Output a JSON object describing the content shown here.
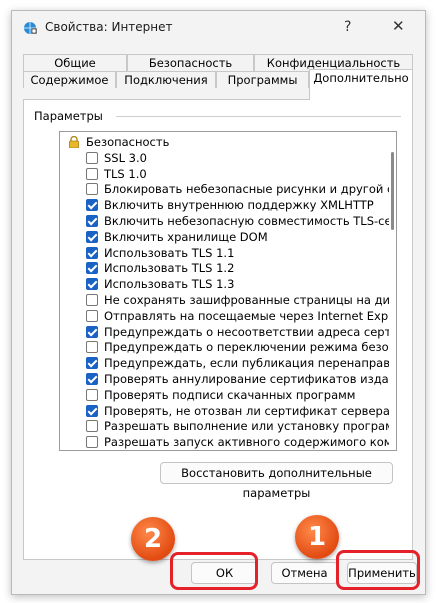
{
  "window": {
    "title": "Свойства: Интернет",
    "help": "?",
    "close": "✕"
  },
  "tabs_row1": [
    "Общие",
    "Безопасность",
    "Конфиденциальность"
  ],
  "tabs_row2": [
    "Содержимое",
    "Подключения",
    "Программы",
    "Дополнительно"
  ],
  "group_label": "Параметры",
  "list_header": "Безопасность",
  "items": [
    {
      "label": "SSL 3.0",
      "checked": false
    },
    {
      "label": "TLS 1.0",
      "checked": false
    },
    {
      "label": "Блокировать небезопасные рисунки и другой смешанн",
      "checked": false
    },
    {
      "label": "Включить внутреннюю поддержку XMLHTTP",
      "checked": true
    },
    {
      "label": "Включить небезопасную совместимость TLS-сервера",
      "checked": true
    },
    {
      "label": "Включить хранилище DOM",
      "checked": true
    },
    {
      "label": "Использовать TLS 1.1",
      "checked": true
    },
    {
      "label": "Использовать TLS 1.2",
      "checked": true
    },
    {
      "label": "Использовать TLS 1.3",
      "checked": true
    },
    {
      "label": "Не сохранять зашифрованные страницы на диск",
      "checked": false
    },
    {
      "label": "Отправлять на посещаемые через Internet Explorer ве",
      "checked": false
    },
    {
      "label": "Предупреждать о несоответствии адреса сертификат",
      "checked": true
    },
    {
      "label": "Предупреждать о переключении режима безопасност",
      "checked": false
    },
    {
      "label": "Предупреждать, если публикация перенаправляется",
      "checked": true
    },
    {
      "label": "Проверять аннулирование сертификатов издателей",
      "checked": true
    },
    {
      "label": "Проверять подписи скачанных программ",
      "checked": false
    },
    {
      "label": "Проверять, не отозван ли сертификат сервера",
      "checked": true
    },
    {
      "label": "Разрешать выполнение или установку программы, име",
      "checked": false
    },
    {
      "label": "Разрешать запуск активного содержимого компакт-ди",
      "checked": false
    }
  ],
  "restore_button": "Восстановить дополнительные параметры",
  "buttons": {
    "ok": "ОК",
    "cancel": "Отмена",
    "apply": "Применить"
  },
  "badges": {
    "apply_step": "1",
    "ok_step": "2"
  },
  "colors": {
    "highlight": "#e5222a",
    "badge": "#e24b12",
    "checkbox": "#1a62c4"
  }
}
